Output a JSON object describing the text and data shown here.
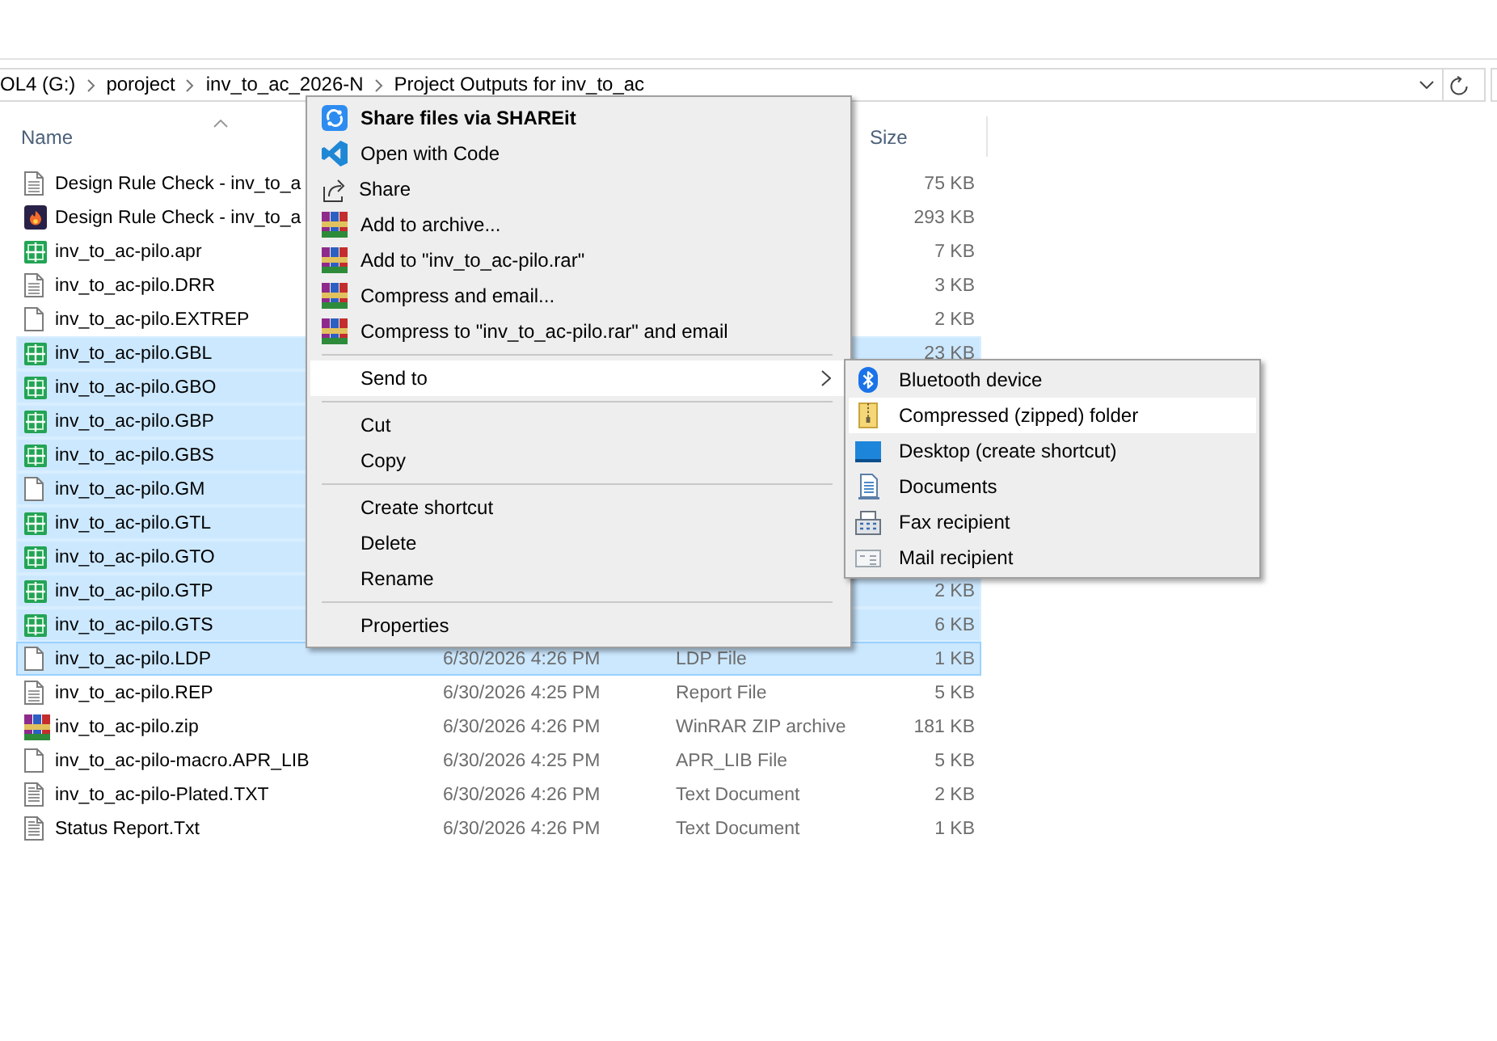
{
  "address_bar": {
    "path": [
      "OL4 (G:)",
      "poroject",
      "inv_to_ac_2026-N",
      "Project Outputs for inv_to_ac"
    ]
  },
  "file_list": {
    "columns": [
      {
        "label": "Name",
        "sorted": true
      },
      {
        "label": "Size",
        "sorted": false
      }
    ],
    "rows": [
      {
        "kind": "lined",
        "name": "Design Rule Check - inv_to_a",
        "size": "75 KB",
        "selected": false,
        "focused": false
      },
      {
        "kind": "app",
        "name": "Design Rule Check - inv_to_a",
        "size": "293 KB",
        "selected": false,
        "focused": false
      },
      {
        "kind": "grid",
        "name": "inv_to_ac-pilo.apr",
        "size": "7 KB",
        "selected": false,
        "focused": false
      },
      {
        "kind": "lined",
        "name": "inv_to_ac-pilo.DRR",
        "size": "3 KB",
        "selected": false,
        "focused": false
      },
      {
        "kind": "blank",
        "name": "inv_to_ac-pilo.EXTREP",
        "size": "2 KB",
        "selected": false,
        "focused": false
      },
      {
        "kind": "grid",
        "name": "inv_to_ac-pilo.GBL",
        "size": "23 KB",
        "selected": true,
        "focused": false
      },
      {
        "kind": "grid",
        "name": "inv_to_ac-pilo.GBO",
        "selected": true,
        "focused": false
      },
      {
        "kind": "grid",
        "name": "inv_to_ac-pilo.GBP",
        "selected": true,
        "focused": false
      },
      {
        "kind": "grid",
        "name": "inv_to_ac-pilo.GBS",
        "selected": true,
        "focused": false
      },
      {
        "kind": "blank",
        "name": "inv_to_ac-pilo.GM",
        "selected": true,
        "focused": false
      },
      {
        "kind": "grid",
        "name": "inv_to_ac-pilo.GTL",
        "selected": true,
        "focused": false
      },
      {
        "kind": "grid",
        "name": "inv_to_ac-pilo.GTO",
        "selected": true,
        "focused": false
      },
      {
        "kind": "grid",
        "name": "inv_to_ac-pilo.GTP",
        "size": "2 KB",
        "selected": true,
        "focused": false
      },
      {
        "kind": "grid",
        "name": "inv_to_ac-pilo.GTS",
        "size": "6 KB",
        "selected": true,
        "focused": false
      },
      {
        "kind": "blank",
        "name": "inv_to_ac-pilo.LDP",
        "column_2": "6/30/2026 4:26 PM",
        "column_3": "LDP File",
        "size": "1 KB",
        "selected": true,
        "focused": true
      },
      {
        "kind": "lined",
        "name": "inv_to_ac-pilo.REP",
        "column_2": "6/30/2026 4:25 PM",
        "column_3": "Report File",
        "size": "5 KB",
        "selected": false,
        "focused": false
      },
      {
        "kind": "archive",
        "name": "inv_to_ac-pilo.zip",
        "column_2": "6/30/2026 4:26 PM",
        "column_3": "WinRAR ZIP archive",
        "size": "181 KB",
        "selected": false,
        "focused": false
      },
      {
        "kind": "blank",
        "name": "inv_to_ac-pilo-macro.APR_LIB",
        "column_2": "6/30/2026 4:25 PM",
        "column_3": "APR_LIB File",
        "size": "5 KB",
        "selected": false,
        "focused": false
      },
      {
        "kind": "text",
        "name": "inv_to_ac-pilo-Plated.TXT",
        "column_2": "6/30/2026 4:26 PM",
        "column_3": "Text Document",
        "size": "2 KB",
        "selected": false,
        "focused": false
      },
      {
        "kind": "text",
        "name": "Status Report.Txt",
        "column_2": "6/30/2026 4:26 PM",
        "column_3": "Text Document",
        "size": "1 KB",
        "selected": false,
        "focused": false
      }
    ]
  },
  "context_menu": {
    "sections": [
      {
        "items": [
          {
            "kind": "sync",
            "label": "Share files via SHAREit",
            "default": true,
            "selected": false
          },
          {
            "kind": "code",
            "label": "Open with Code",
            "default": false,
            "selected": false
          },
          {
            "kind": "share",
            "label": "Share",
            "default": false,
            "selected": false
          },
          {
            "kind": "archive",
            "label": "Add to archive...",
            "default": false,
            "selected": false
          },
          {
            "kind": "archive",
            "label": "Add to \"inv_to_ac-pilo.rar\"",
            "default": false,
            "selected": false
          },
          {
            "kind": "archive",
            "label": "Compress and email...",
            "default": false,
            "selected": false
          },
          {
            "kind": "archive",
            "label": "Compress to \"inv_to_ac-pilo.rar\" and email",
            "default": false,
            "selected": false
          }
        ]
      },
      {
        "items": [
          {
            "kind": "submenu",
            "label": "Send to",
            "default": false,
            "selected": true
          }
        ]
      },
      {
        "items": [
          {
            "kind": "plain",
            "label": "Cut",
            "default": false,
            "selected": false
          },
          {
            "kind": "plain",
            "label": "Copy",
            "default": false,
            "selected": false
          }
        ]
      },
      {
        "items": [
          {
            "kind": "plain",
            "label": "Create shortcut",
            "default": false,
            "selected": false
          },
          {
            "kind": "plain",
            "label": "Delete",
            "default": false,
            "selected": false
          },
          {
            "kind": "plain",
            "label": "Rename",
            "default": false,
            "selected": false
          }
        ]
      },
      {
        "items": [
          {
            "kind": "plain",
            "label": "Properties",
            "default": false,
            "selected": false
          }
        ]
      }
    ]
  },
  "send_to_menu": {
    "items": [
      {
        "kind": "bluetooth",
        "label": "Bluetooth device",
        "selected": false
      },
      {
        "kind": "zip",
        "label": "Compressed (zipped) folder",
        "selected": true
      },
      {
        "kind": "desktop",
        "label": "Desktop (create shortcut)",
        "selected": false
      },
      {
        "kind": "documents",
        "label": "Documents",
        "selected": false
      },
      {
        "kind": "fax",
        "label": "Fax recipient",
        "selected": false
      },
      {
        "kind": "mail",
        "label": "Mail recipient",
        "selected": false
      }
    ]
  }
}
